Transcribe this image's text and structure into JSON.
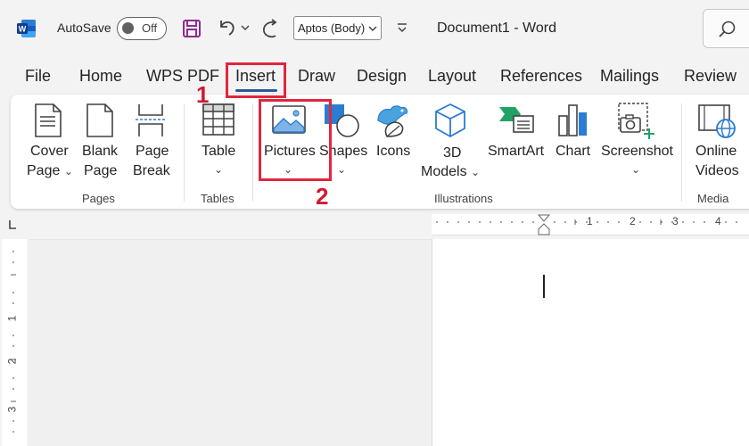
{
  "titlebar": {
    "app_icon": "word-logo",
    "autosave_label": "AutoSave",
    "autosave_state": "Off",
    "font_name": "Aptos (Body)",
    "document_title": "Document1  -  Word",
    "icons": [
      "save-icon",
      "undo-icon",
      "redo-icon",
      "customize-quick-access-icon",
      "search-icon"
    ]
  },
  "tabs": [
    {
      "label": "File"
    },
    {
      "label": "Home"
    },
    {
      "label": "WPS PDF"
    },
    {
      "label": "Insert",
      "active": true
    },
    {
      "label": "Draw"
    },
    {
      "label": "Design"
    },
    {
      "label": "Layout"
    },
    {
      "label": "References"
    },
    {
      "label": "Mailings"
    },
    {
      "label": "Review"
    }
  ],
  "annotations": {
    "step1": "1",
    "step2": "2",
    "color": "#e0263d"
  },
  "ribbon": {
    "groups": {
      "pages": "Pages",
      "tables": "Tables",
      "illustrations": "Illustrations",
      "media": "Media"
    },
    "buttons": {
      "cover_page_1": "Cover",
      "cover_page_2": "Page",
      "blank_page_1": "Blank",
      "blank_page_2": "Page",
      "page_break_1": "Page",
      "page_break_2": "Break",
      "table": "Table",
      "pictures": "Pictures",
      "shapes": "Shapes",
      "icons": "Icons",
      "models_1": "3D",
      "models_2": "Models",
      "smartart": "SmartArt",
      "chart": "Chart",
      "screenshot": "Screenshot",
      "online_videos_1": "Online",
      "online_videos_2": "Videos"
    }
  },
  "ruler": {
    "h_ticks": [
      "1",
      "2",
      "3",
      "4"
    ],
    "v_ticks": [
      "1",
      "2",
      "3"
    ]
  },
  "colors": {
    "accent": "#2b579a",
    "word_blue": "#185abd",
    "save_purple": "#8e2c8f",
    "annotation_red": "#e0263d"
  }
}
